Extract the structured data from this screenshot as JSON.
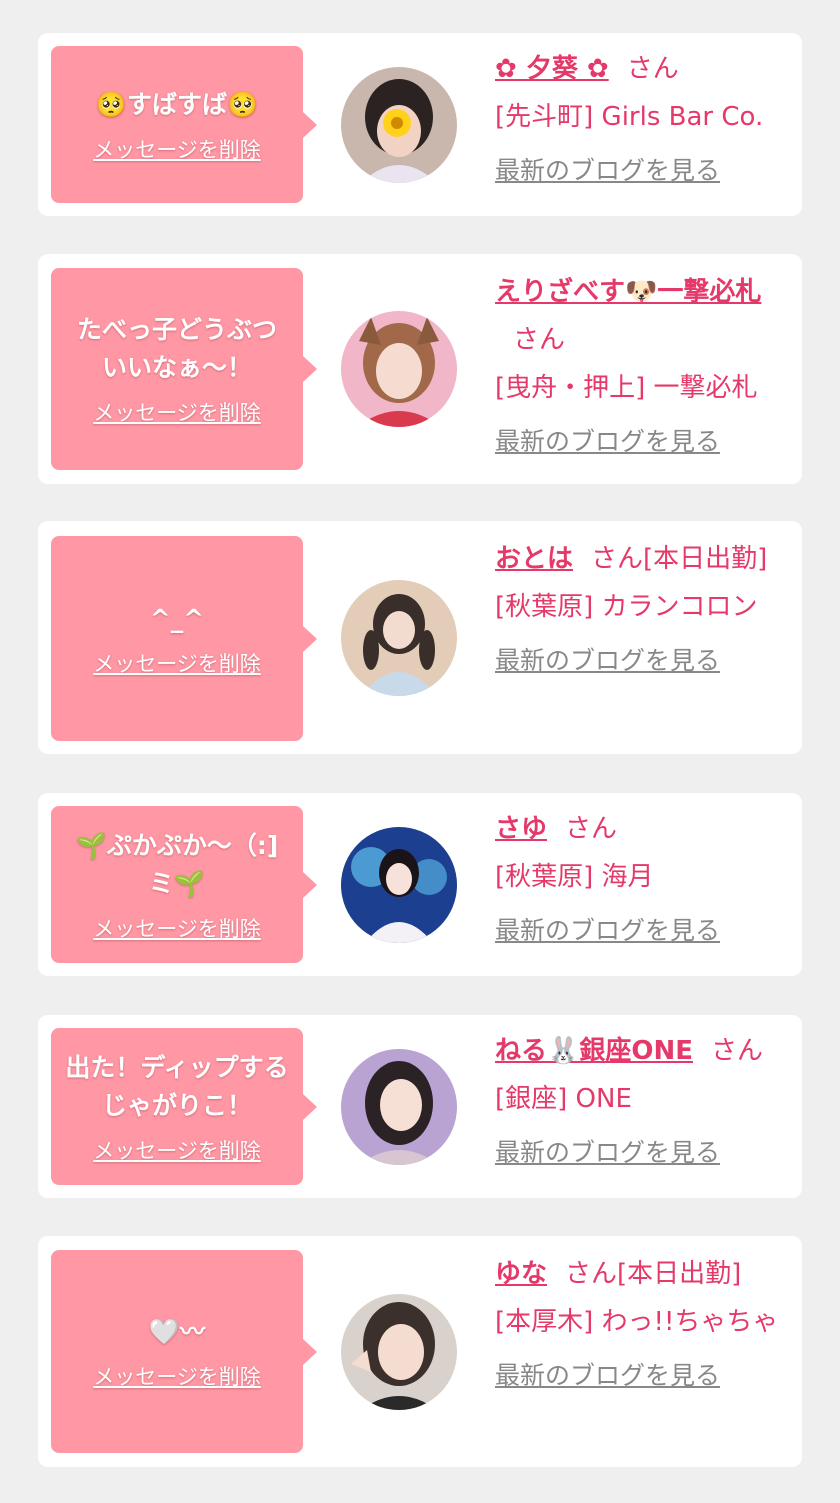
{
  "delete_label": "メッセージを削除",
  "blog_label": "最新のブログを見る",
  "san_suffix": "さん",
  "colors": {
    "background": "#efefef",
    "bubble": "#ff97a4",
    "accent_text": "#e5396a",
    "link_gray": "#888888"
  },
  "cards": [
    {
      "message": "🥺すばすば🥺",
      "name": "✿ 夕葵 ✿",
      "status": "",
      "shop": "[先斗町] Girls Bar Co.",
      "avatar_icon": "avatar-photo-icon"
    },
    {
      "message": "たべっ子どうぶついいなぁ～！",
      "name": "えりざべす🐶一撃必札",
      "status": "",
      "shop": "[曳舟・押上] 一撃必札",
      "avatar_icon": "avatar-photo-icon"
    },
    {
      "message": "^_^",
      "name": "おとは",
      "status": "[本日出勤]",
      "shop": "[秋葉原] カランコロン",
      "avatar_icon": "avatar-photo-icon"
    },
    {
      "message": "🌱ぷかぷか～（:]ミ🌱",
      "name": "さゆ",
      "status": "",
      "shop": "[秋葉原] 海月",
      "avatar_icon": "avatar-photo-icon"
    },
    {
      "message": "出た！ディップするじゃがりこ！",
      "name": "ねる🐰銀座ONE",
      "status": "",
      "shop": "[銀座] ONE",
      "avatar_icon": "avatar-photo-icon"
    },
    {
      "message": "🤍〰",
      "name": "ゆな",
      "status": "[本日出勤]",
      "shop": "[本厚木] わっ!!ちゃちゃ",
      "avatar_icon": "avatar-photo-icon"
    }
  ]
}
